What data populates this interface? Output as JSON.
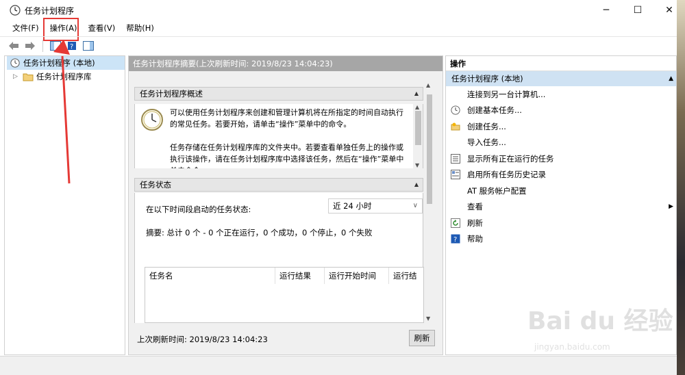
{
  "window": {
    "title": "任务计划程序",
    "controls": [
      "─",
      "☐",
      "✕"
    ]
  },
  "menu": [
    "文件(F)",
    "操作(A)",
    "查看(V)",
    "帮助(H)"
  ],
  "tree": {
    "root": "任务计划程序 (本地)",
    "child": "任务计划程序库"
  },
  "center": {
    "header": "任务计划程序摘要(上次刷新时间: 2019/8/23 14:04:23)",
    "overview_title": "任务计划程序概述",
    "overview_p1": "可以使用任务计划程序来创建和管理计算机将在所指定的时间自动执行的常见任务。若要开始，请单击“操作”菜单中的命令。",
    "overview_p2": "任务存储在任务计划程序库的文件夹中。若要查看单独任务上的操作或执行该操作，请在任务计划程序库中选择该任务，然后在“操作”菜单中单击命令。",
    "status_title": "任务状态",
    "status_label": "在以下时间段启动的任务状态:",
    "period": "近 24 小时",
    "summary": "摘要: 总计 0 个 - 0 个正在运行，0 个成功，0 个停止，0 个失败",
    "columns": [
      "任务名",
      "运行结果",
      "运行开始时间",
      "运行结"
    ],
    "last_refresh": "上次刷新时间: 2019/8/23 14:04:23",
    "refresh_button": "刷新"
  },
  "actions": {
    "title": "操作",
    "group": "任务计划程序 (本地)",
    "items": [
      {
        "label": "连接到另一台计算机...",
        "icon": "none"
      },
      {
        "label": "创建基本任务...",
        "icon": "clock-icon"
      },
      {
        "label": "创建任务...",
        "icon": "new-task-icon"
      },
      {
        "label": "导入任务...",
        "icon": "none"
      },
      {
        "label": "显示所有正在运行的任务",
        "icon": "list-icon"
      },
      {
        "label": "启用所有任务历史记录",
        "icon": "history-icon"
      },
      {
        "label": "AT 服务帐户配置",
        "icon": "none"
      },
      {
        "label": "查看",
        "icon": "none"
      },
      {
        "label": "刷新",
        "icon": "refresh-icon"
      },
      {
        "label": "帮助",
        "icon": "help-icon"
      }
    ]
  },
  "watermark": {
    "text": "Bai du 经验",
    "sub": "jingyan.baidu.com"
  },
  "colors": {
    "selection": "#cce4f7",
    "header_gray": "#a6a6a6",
    "highlight_red": "#e53935"
  }
}
